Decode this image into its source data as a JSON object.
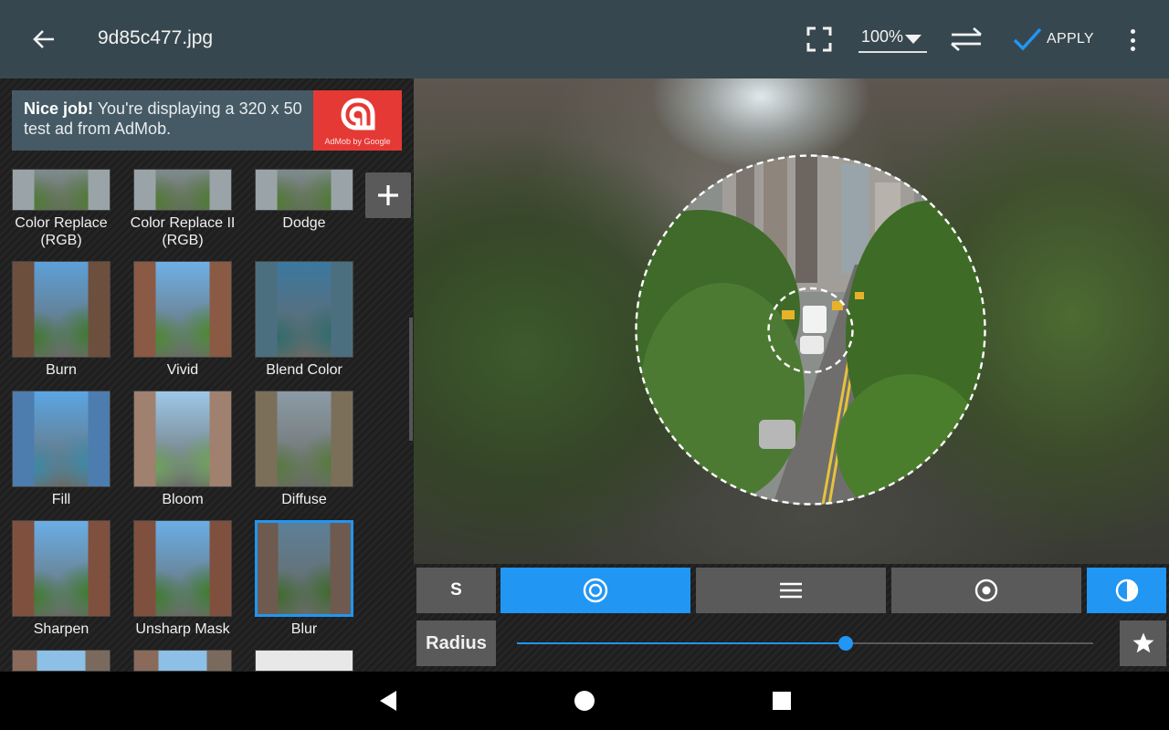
{
  "header": {
    "filename": "9d85c477.jpg",
    "zoom_value": "100%",
    "apply_label": "APPLY",
    "accent_color": "#2196f3"
  },
  "ad": {
    "bold_text": "Nice job!",
    "text": " You're displaying a 320 x 50 test ad from AdMob.",
    "badge": "AdMob by Google"
  },
  "effects": [
    {
      "label": "Color Replace (RGB)"
    },
    {
      "label": "Color Replace II (RGB)"
    },
    {
      "label": "Dodge"
    },
    {
      "label": "Burn"
    },
    {
      "label": "Vivid"
    },
    {
      "label": "Blend Color"
    },
    {
      "label": "Fill"
    },
    {
      "label": "Bloom"
    },
    {
      "label": "Diffuse"
    },
    {
      "label": "Sharpen"
    },
    {
      "label": "Unsharp Mask"
    },
    {
      "label": "Blur",
      "selected": true
    }
  ],
  "tools": {
    "s_label": "S",
    "radius_label": "Radius",
    "radius_value": 0.57,
    "active_modes": [
      "radial-blur",
      "contrast"
    ]
  },
  "icons": [
    "back-arrow-icon",
    "fullscreen-icon",
    "swap-icon",
    "check-icon",
    "more-vert-icon",
    "plus-icon",
    "target-icon",
    "lines-icon",
    "dot-circle-icon",
    "half-circle-icon",
    "star-icon",
    "nav-back-icon",
    "nav-home-icon",
    "nav-recents-icon"
  ]
}
